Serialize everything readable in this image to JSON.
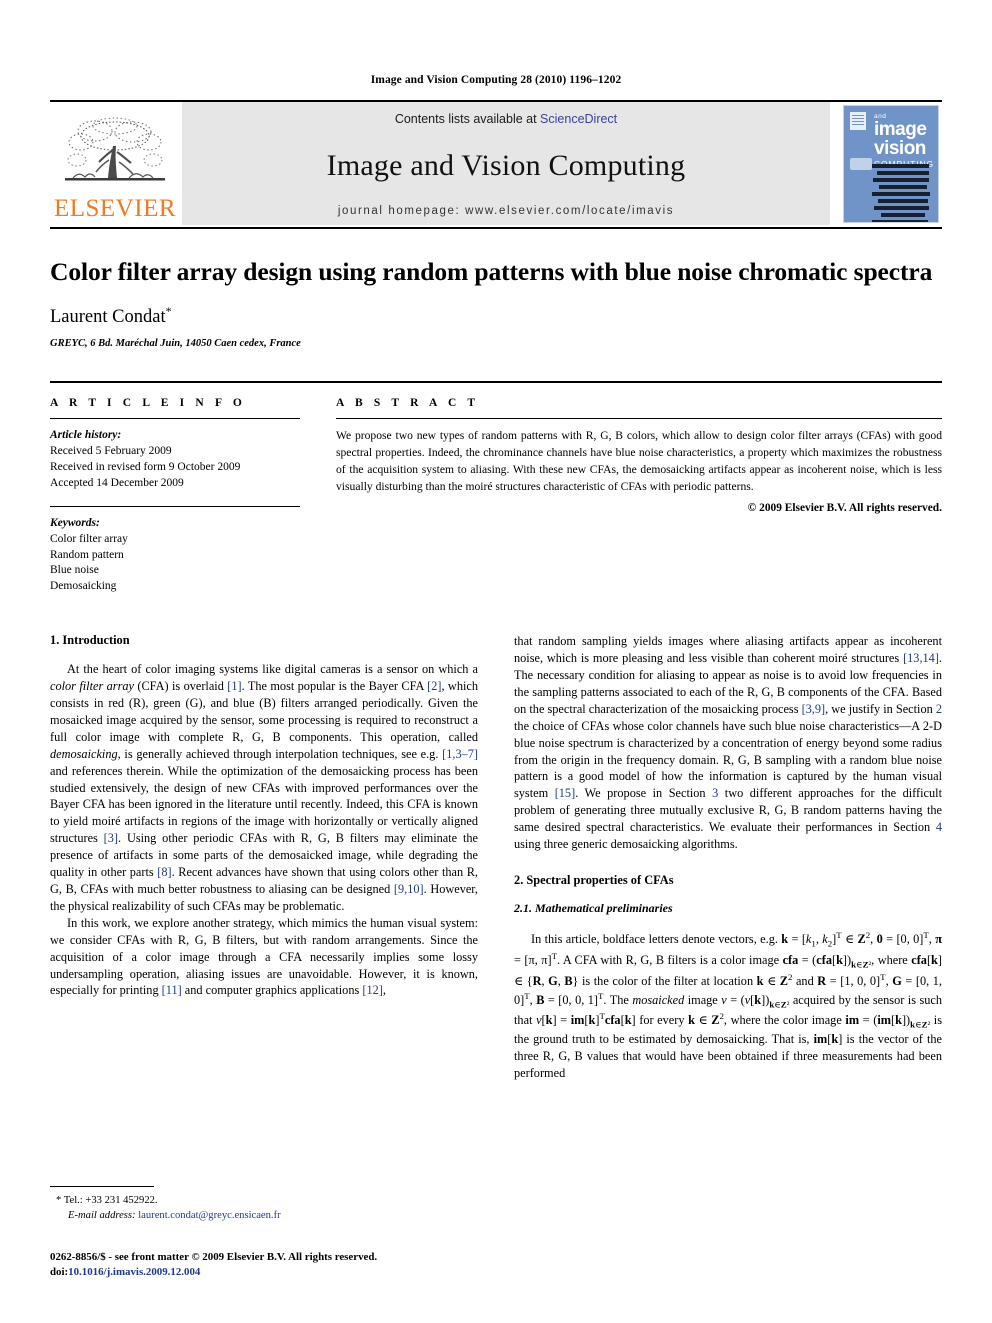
{
  "running_head": "Image and Vision Computing 28 (2010) 1196–1202",
  "masthead": {
    "publisher": "ELSEVIER",
    "contents_prefix": "Contents lists available at ",
    "sciencedirect": "ScienceDirect",
    "journal_title": "Image and Vision Computing",
    "homepage": "journal homepage: www.elsevier.com/locate/imavis",
    "cover": {
      "line1": "image",
      "and": "and",
      "line2": "vision",
      "line3": "COMPUTING"
    }
  },
  "article": {
    "title": "Color filter array design using random patterns with blue noise chromatic spectra",
    "author": "Laurent Condat",
    "author_marker": "*",
    "affiliation": "GREYC, 6 Bd. Maréchal Juin, 14050 Caen cedex, France"
  },
  "info": {
    "heading": "A R T I C L E   I N F O",
    "history_label": "Article history:",
    "history": [
      "Received 5 February 2009",
      "Received in revised form 9 October 2009",
      "Accepted 14 December 2009"
    ],
    "keywords_label": "Keywords:",
    "keywords": [
      "Color filter array",
      "Random pattern",
      "Blue noise",
      "Demosaicking"
    ]
  },
  "abstract": {
    "heading": "A B S T R A C T",
    "text": "We propose two new types of random patterns with R, G, B colors, which allow to design color filter arrays (CFAs) with good spectral properties. Indeed, the chrominance channels have blue noise characteristics, a property which maximizes the robustness of the acquisition system to aliasing. With these new CFAs, the demosaicking artifacts appear as incoherent noise, which is less visually disturbing than the moiré structures characteristic of CFAs with periodic patterns.",
    "copyright": "© 2009 Elsevier B.V. All rights reserved."
  },
  "sections": {
    "introduction_heading": "1. Introduction",
    "spectral_heading": "2. Spectral properties of CFAs",
    "math_prelim_heading": "2.1. Mathematical preliminaries"
  },
  "body": {
    "intro_p1_a": "At the heart of color imaging systems like digital cameras is a sensor on which a ",
    "intro_p1_italic": "color filter array",
    "intro_p1_b": " (CFA) is overlaid ",
    "cit1": "[1]",
    "intro_p1_c": ". The most popular is the Bayer CFA ",
    "cit2": "[2]",
    "intro_p1_d": ", which consists in red (R), green (G), and blue (B) filters arranged periodically. Given the mosaicked image acquired by the sensor, some processing is required to reconstruct a full color image with complete R, G, B components. This operation, called ",
    "intro_p1_italic2": "demosaicking",
    "intro_p1_e": ", is generally achieved through interpolation techniques, see e.g. ",
    "cit3": "[1,3–7]",
    "intro_p1_f": " and references therein. While the optimization of the demosaicking process has been studied extensively, the design of new CFAs with improved performances over the Bayer CFA has been ignored in the literature until recently. Indeed, this CFA is known to yield moiré artifacts in regions of the image with horizontally or vertically aligned structures ",
    "cit4": "[3]",
    "intro_p1_g": ". Using other periodic CFAs with R, G, B filters may eliminate the presence of artifacts in some parts of the demosaicked image, while degrading the quality in other parts ",
    "cit5": "[8]",
    "intro_p1_h": ". Recent advances have shown that using colors other than R, G, B, CFAs with much better robustness to aliasing can be designed ",
    "cit6": "[9,10]",
    "intro_p1_i": ". However, the physical realizability of such CFAs may be problematic.",
    "intro_p2_a": "In this work, we explore another strategy, which mimics the human visual system: we consider CFAs with R, G, B filters, but with random arrangements. Since the acquisition of a color image through a CFA necessarily implies some lossy undersampling operation, aliasing issues are unavoidable. However, it is known, especially for printing ",
    "cit7": "[11]",
    "intro_p2_b": " and computer graphics applications ",
    "cit8": "[12]",
    "intro_p2_c": ", that random sampling yields images where aliasing artifacts appear as incoherent noise, which is more pleasing and less visible than coherent moiré structures ",
    "cit9": "[13,14]",
    "intro_p2_d": ". The necessary condition for aliasing to appear as noise is to avoid low frequencies in the sampling patterns associated to each of the R, G, B components of the CFA. Based on the spectral characterization of the mosaicking process ",
    "cit10": "[3,9]",
    "intro_p2_e": ", we justify in Section ",
    "ref_sec2": "2",
    "intro_p2_f": " the choice of CFAs whose color channels have such blue noise characteristics—A 2-D blue noise spectrum is characterized by a concentration of energy beyond some radius from the origin in the frequency domain. R, G, B sampling with a random blue noise pattern is a good model of how the information is captured by the human visual system ",
    "cit11": "[15]",
    "intro_p2_g": ". We propose in Section ",
    "ref_sec3": "3",
    "intro_p2_h": " two different approaches for the difficult problem of generating three mutually exclusive R, G, B random patterns having the same desired spectral characteristics. We evaluate their performances in Section ",
    "ref_sec4": "4",
    "intro_p2_i": " using three generic demosaicking algorithms.",
    "math_p1_a": "In this article, boldface letters denote vectors, e.g. ",
    "math_k": "k",
    "math_eq1": " = [k",
    "math_sub1": "1",
    "math_eq1b": ", k",
    "math_sub2": "2",
    "math_eq1c": "]",
    "math_sup_T1": "T",
    "math_p1_b": " ∈ ",
    "math_Z2": "Z",
    "math_sup_2": "2",
    "math_p1_c": ", 0 = [0,0]",
    "math_p1_d": ", π = [π, π]",
    "math_p1_e": ". A CFA with R, G, B filters is a color image ",
    "math_cfa": "cfa",
    "math_p1_f": " = (cfa[k])",
    "math_sub_kz": "k∈Z²",
    "math_p1_g": ", where cfa[k] ∈ {R, G, B} is the color of the filter at location k ∈ Z",
    "math_p1_h": " and R = [1,0,0]",
    "math_p1_i": ", G = [0,1,0]",
    "math_p1_j": ", B = [0,0,1]",
    "math_p1_k": ". The ",
    "math_mosaicked": "mosaicked",
    "math_p1_l": " image ν = (ν[k])",
    "math_p1_m": " acquired by the sensor is such that ν[k] = im[k]",
    "math_p1_n": "cfa[k] for every k ∈ Z",
    "math_p1_o": ", where the color image im = (im[k])",
    "math_p1_p": " is the ground truth to be estimated by demosaicking. That is, im[k] is the vector of the three R, G, B values that would have been obtained if three measurements had been performed"
  },
  "footnote": {
    "marker": "*",
    "tel": "Tel.: +33 231 452922.",
    "email_label": "E-mail address:",
    "email": "laurent.condat@greyc.ensicaen.fr"
  },
  "issn": {
    "line1": "0262-8856/$ - see front matter © 2009 Elsevier B.V. All rights reserved.",
    "doi_label": "doi:",
    "doi": "10.1016/j.imavis.2009.12.004"
  },
  "colors": {
    "elsevier_orange": "#F47920",
    "link_blue": "#20398a",
    "sciencedirect_blue": "#3b3fa0",
    "banner_gray": "#e6e6e6",
    "cover_blue": "#7094c8"
  }
}
